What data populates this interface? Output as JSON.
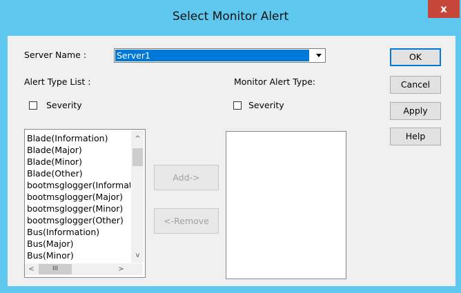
{
  "window": {
    "title": "Select Monitor Alert",
    "close_glyph": "x"
  },
  "server": {
    "label": "Server Name :",
    "value": "Server1"
  },
  "alert_type_list": {
    "label": "Alert Type List :",
    "severity_label": "Severity",
    "severity_checked": false,
    "items": [
      "Blade(Information)",
      "Blade(Major)",
      "Blade(Minor)",
      "Blade(Other)",
      "bootmsglogger(Information)",
      "bootmsglogger(Major)",
      "bootmsglogger(Minor)",
      "bootmsglogger(Other)",
      "Bus(Information)",
      "Bus(Major)",
      "Bus(Minor)"
    ]
  },
  "monitor_alert_type": {
    "label": "Monitor Alert Type:",
    "severity_label": "Severity",
    "severity_checked": false,
    "items": []
  },
  "buttons": {
    "add": "Add->",
    "remove": "<-Remove",
    "ok": "OK",
    "cancel": "Cancel",
    "apply": "Apply",
    "help": "Help"
  },
  "scrollbar_glyphs": {
    "up": "^",
    "down": "v",
    "left": "<",
    "right": ">",
    "grip": "III"
  }
}
